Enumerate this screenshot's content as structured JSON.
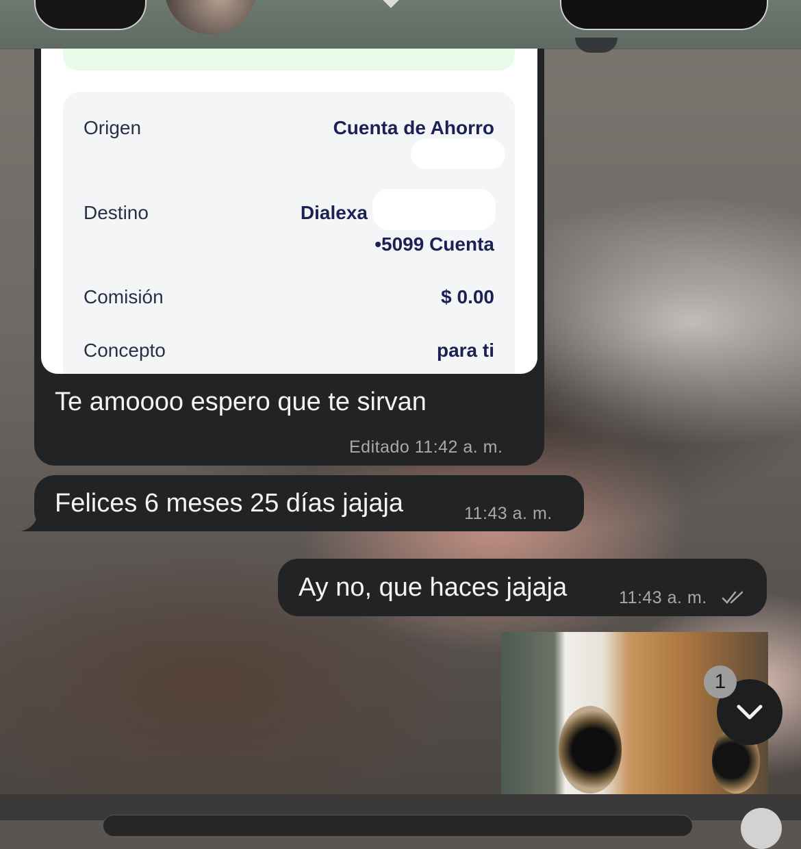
{
  "receipt": {
    "rows": [
      {
        "label": "Origen",
        "value": "Cuenta de Ahorro",
        "value2": ""
      },
      {
        "label": "Destino",
        "value": "Dialexa",
        "value2": "•5099 Cuenta"
      },
      {
        "label": "Comisión",
        "value": "$ 0.00",
        "value2": ""
      },
      {
        "label": "Concepto",
        "value": "para ti",
        "value2": ""
      }
    ]
  },
  "messages": [
    {
      "text": "Te amoooo espero que te  sirvan",
      "meta": "Editado 11:42 a. m.",
      "direction": "incoming"
    },
    {
      "text": "Felices 6 meses 25 días jajaja",
      "meta": "11:43 a. m.",
      "direction": "incoming"
    },
    {
      "text": "Ay no, que haces jajaja",
      "meta": "11:43 a. m.",
      "direction": "outgoing",
      "status": "read"
    }
  ],
  "scroll_down": {
    "unread_count": "1"
  },
  "icons": {
    "scroll": "chevron-down-icon",
    "read_status": "double-check-icon"
  },
  "colors": {
    "bubble": "#222324",
    "receipt_text": "#1b2153",
    "meta_text": "#a9a9a9"
  }
}
